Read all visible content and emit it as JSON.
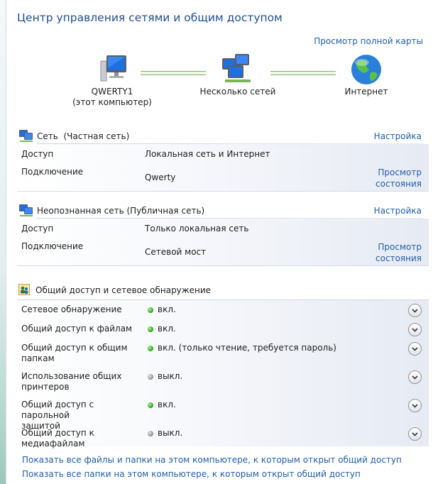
{
  "title": "Центр управления сетями и общим доступом",
  "full_map_link": "Просмотр полной карты",
  "map": {
    "computer": {
      "name": "QWERTY1",
      "sub": "(этот компьютер)"
    },
    "networks": "Несколько сетей",
    "internet": "Интернет"
  },
  "network1": {
    "name": "Сеть",
    "type": "(Частная сеть)",
    "configure": "Настройка",
    "access_label": "Доступ",
    "access_value": "Локальная сеть и Интернет",
    "connection_label": "Подключение",
    "connection_value": "Qwerty",
    "status_line1": "Просмотр",
    "status_line2": "состояния"
  },
  "network2": {
    "name": "Неопознанная сеть",
    "type": "(Публичная сеть)",
    "configure": "Настройка",
    "access_label": "Доступ",
    "access_value": "Только локальная сеть",
    "connection_label": "Подключение",
    "connection_value": "Сетевой мост",
    "status_line1": "Просмотр",
    "status_line2": "состояния"
  },
  "sharing": {
    "title": "Общий доступ и сетевое обнаружение",
    "rows": [
      {
        "label1": "Сетевое обнаружение",
        "label2": "",
        "state": "on",
        "status": "вкл."
      },
      {
        "label1": "Общий доступ к файлам",
        "label2": "",
        "state": "on",
        "status": "вкл."
      },
      {
        "label1": "Общий доступ к общим",
        "label2": "папкам",
        "state": "on",
        "status": "вкл. (только чтение, требуется пароль)"
      },
      {
        "label1": "Использование общих",
        "label2": "принтеров",
        "state": "off",
        "status": "выкл."
      },
      {
        "label1": "Общий доступ с парольной",
        "label2": "защитой",
        "state": "on",
        "status": "вкл."
      },
      {
        "label1": "Общий доступ к медиафайлам",
        "label2": "",
        "state": "off",
        "status": "выкл."
      }
    ]
  },
  "links": {
    "show_files": "Показать все файлы и папки на этом компьютере, к которым открыт общий доступ",
    "show_folders": "Показать все папки на этом компьютере, к которым открыт общий доступ"
  },
  "colors": {
    "title": "#1f4f8f",
    "link": "#1f5fa8",
    "status_on": "#2f9e1c",
    "status_off": "#8c8c8c"
  },
  "icons": {
    "computer": "computer-icon",
    "networks": "network-icon",
    "internet": "globe-icon",
    "section_network": "network-small-icon",
    "sharing": "sharing-icon",
    "expand": "chevron-down-icon"
  }
}
